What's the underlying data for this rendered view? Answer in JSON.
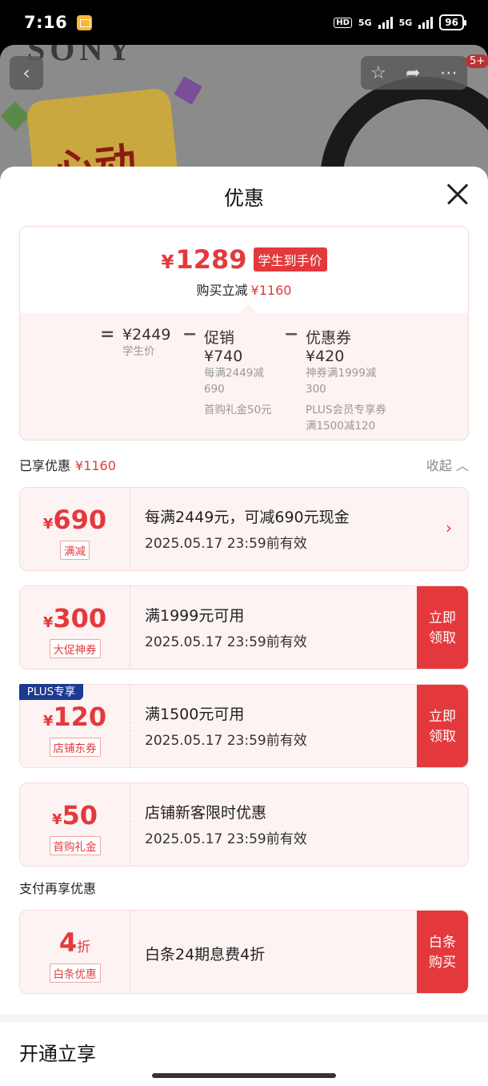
{
  "status_bar": {
    "time": "7:16",
    "battery": "96",
    "net1": "5G",
    "net2": "5G",
    "hd": "HD"
  },
  "background": {
    "brand": "SONY",
    "promo": "心动",
    "more_badge": "5+"
  },
  "sheet": {
    "title": "优惠"
  },
  "summary": {
    "final_price": "1289",
    "currency": "¥",
    "price_tag": "学生到手价",
    "reduce_label": "购买立减",
    "reduce_amount": "¥1160",
    "student_price": "¥2449",
    "student_label": "学生价",
    "promo_amount": "促销 ¥740",
    "promo_detail": "每满2449减690",
    "promo_gift": "首购礼金50元",
    "coupon_amount": "优惠券 ¥420",
    "coupon_detail": "神券满1999减300",
    "coupon_plus": "PLUS会员专享券",
    "coupon_plus_detail": "满1500减120"
  },
  "enjoyed": {
    "label": "已享优惠",
    "amount": "¥1160",
    "collapse": "收起"
  },
  "coupons": [
    {
      "amount": "690",
      "tag": "满减",
      "line1": "每满2449元，可减690元现金",
      "line2": "2025.05.17 23:59前有效"
    },
    {
      "amount": "300",
      "tag": "大促神券",
      "line1": "满1999元可用",
      "line2": "2025.05.17 23:59前有效",
      "action": "立即领取"
    },
    {
      "amount": "120",
      "tag": "店铺东券",
      "line1": "满1500元可用",
      "line2": "2025.05.17 23:59前有效",
      "action": "立即领取",
      "badge": "PLUS专享"
    },
    {
      "amount": "50",
      "tag": "首购礼金",
      "line1": "店铺新客限时优惠",
      "line2": "2025.05.17 23:59前有效"
    }
  ],
  "payment": {
    "label": "支付再享优惠",
    "amount": "4",
    "unit": "折",
    "tag": "白条优惠",
    "line1": "白条24期息费4折",
    "action": "白条购买"
  },
  "open": {
    "title": "开通立享"
  }
}
